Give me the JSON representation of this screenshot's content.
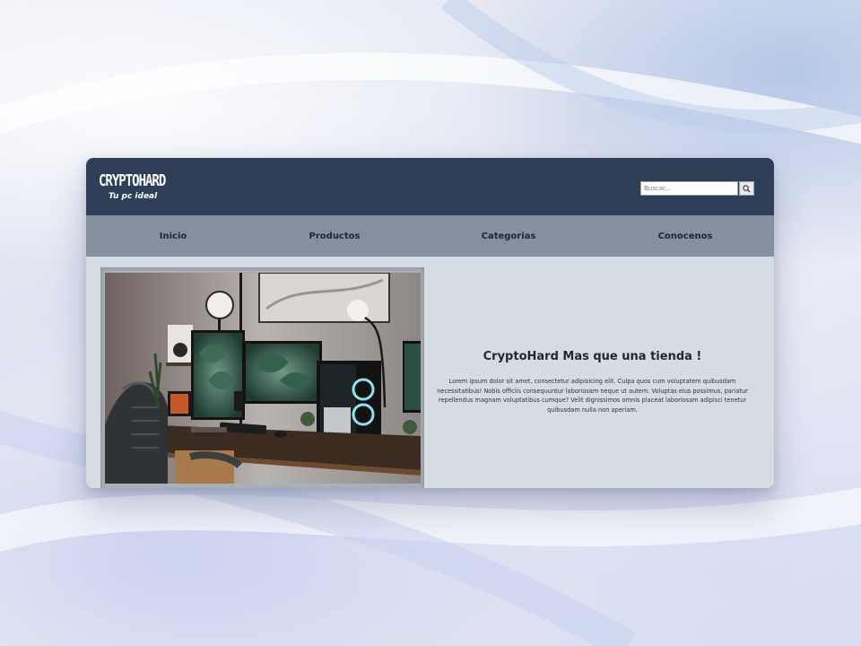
{
  "brand": {
    "logo_text": "CRYPTOHARD",
    "tagline": "Tu pc ideal"
  },
  "search": {
    "placeholder": "Buscar...",
    "icon": "search-icon"
  },
  "nav": {
    "items": [
      {
        "label": "Inicio"
      },
      {
        "label": "Productos"
      },
      {
        "label": "Categorias"
      },
      {
        "label": "Conocenos"
      }
    ]
  },
  "hero": {
    "title": "CryptoHard Mas que una tienda !",
    "body": "Lorem ipsum dolor sit amet, consectetur adipisicing elit. Culpa quos cum voluptatem quibusdam necessitatibus! Nobis officiis consequuntur laboriosam neque ut autem. Voluptas eius possimus, pariatur repellendus magnam voluptatibus cumque? Velit dignissimos omnis placeat laboriosam adipisci tenetur quibusdam nulla non aperiam."
  },
  "colors": {
    "header": "#2e3e57",
    "nav": "#8490a0",
    "content": "#d6dde2",
    "text": "#1f2735"
  }
}
